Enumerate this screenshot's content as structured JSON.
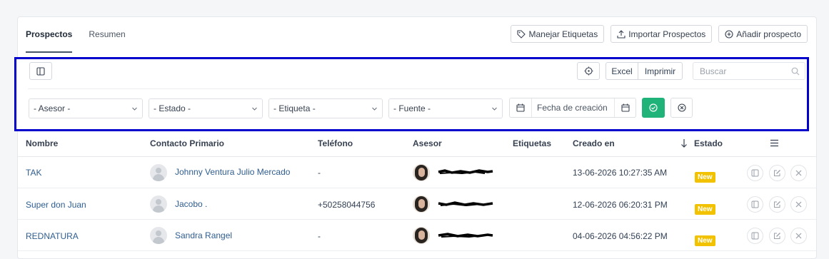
{
  "tabs": [
    {
      "label": "Prospectos",
      "active": true
    },
    {
      "label": "Resumen",
      "active": false
    }
  ],
  "actions": {
    "manage_tags": "Manejar Etiquetas",
    "import": "Importar Prospectos",
    "add": "Añadir prospecto"
  },
  "toolbar": {
    "excel": "Excel",
    "print": "Imprimir",
    "search_placeholder": "Buscar"
  },
  "filters": {
    "advisor": "- Asesor -",
    "status": "- Estado -",
    "tag": "- Etiqueta -",
    "source": "- Fuente -",
    "date_label": "Fecha de creación"
  },
  "colors": {
    "apply": "#1fb37a",
    "badge": "#f2c200",
    "link": "#2f5d90",
    "highlight_border": "#0000cc"
  },
  "table": {
    "headers": {
      "name": "Nombre",
      "contact": "Contacto Primario",
      "phone": "Teléfono",
      "advisor": "Asesor",
      "tags": "Etiquetas",
      "created": "Creado en",
      "status": "Estado"
    },
    "rows": [
      {
        "name": "TAK",
        "contact": "Johnny Ventura Julio Mercado",
        "phone": "-",
        "created": "13-06-2026 10:27:35 AM",
        "status": "New"
      },
      {
        "name": "Super don Juan",
        "contact": "Jacobo .",
        "phone": "+50258044756",
        "created": "12-06-2026 06:20:31 PM",
        "status": "New"
      },
      {
        "name": "REDNATURA",
        "contact": "Sandra Rangel",
        "phone": "-",
        "created": "04-06-2026 04:56:22 PM",
        "status": "New"
      }
    ]
  }
}
